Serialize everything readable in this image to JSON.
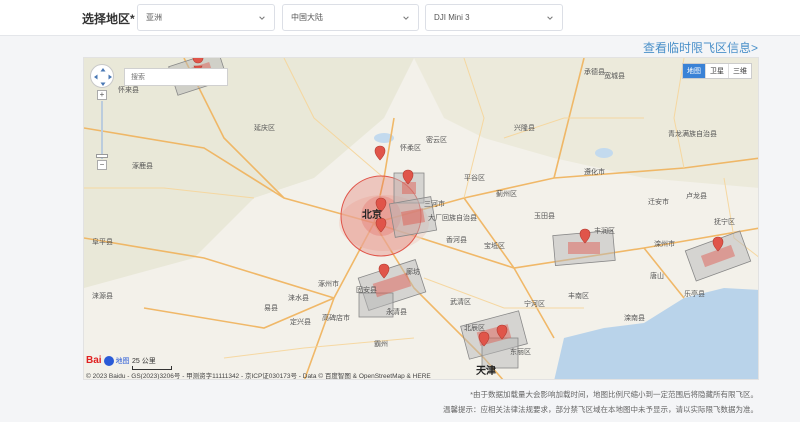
{
  "header": {
    "region_label": "选择地区*",
    "continent": "亚洲",
    "country": "中国大陆",
    "drone": "DJI Mini 3",
    "notice_link": "查看临时限飞区信息>"
  },
  "map": {
    "search_placeholder": "搜索",
    "map_types": [
      "地图",
      "卫星",
      "三维"
    ],
    "active_type": "地图",
    "zoom_in": "+",
    "zoom_out": "−",
    "scale_label": "25 公里",
    "logo": "Bai",
    "logo_sub": "地图",
    "copyright": "© 2023 Baidu - GS(2023)3206号 - 甲测资字11111342 - 京ICP证030173号 - Data © 百度智图 & OpenStreetMap & HERE",
    "cities": {
      "beijing": "北京",
      "tianjin": "天津",
      "c1": "怀柔区",
      "c2": "平谷区",
      "c3": "蓟州区",
      "c4": "三河市",
      "c5": "大厂回族自治县",
      "c6": "香河县",
      "c7": "宝坻区",
      "c8": "玉田县",
      "c9": "丰润区",
      "c10": "滦州市",
      "c11": "迁安市",
      "c12": "宽城县",
      "c13": "兴隆县",
      "c14": "承德县",
      "c15": "遵化市",
      "c16": "密云区",
      "c17": "涿州市",
      "c18": "固安县",
      "c19": "永清县",
      "c20": "霸州",
      "c21": "武清区",
      "c22": "易县",
      "c23": "涞水县",
      "c24": "定兴县",
      "c25": "高碑店市",
      "c26": "廊坊",
      "c27": "延庆区",
      "c28": "怀来县",
      "c29": "涿鹿县",
      "c30": "涞源县",
      "c31": "阜平县",
      "c32": "唐山",
      "c33": "丰南区",
      "c34": "乐亭县",
      "c35": "滦南县",
      "c36": "宁河区",
      "c37": "北辰区",
      "c38": "东丽区",
      "c39": "青龙满族自治县",
      "c40": "卢龙县",
      "c41": "抚宁区"
    }
  },
  "footnotes": [
    "*由于数据加载量大会影响加载时间，地图比例尺缩小到一定范围后将隐藏所有限飞区。",
    "温馨提示：应相关法律法规要求，部分禁飞区域在本地图中未予显示，请以实际限飞数据为准。"
  ],
  "colors": {
    "accent": "#4a90c9",
    "zone_red": "#e0554a",
    "zone_gray": "#b8b8b8"
  }
}
